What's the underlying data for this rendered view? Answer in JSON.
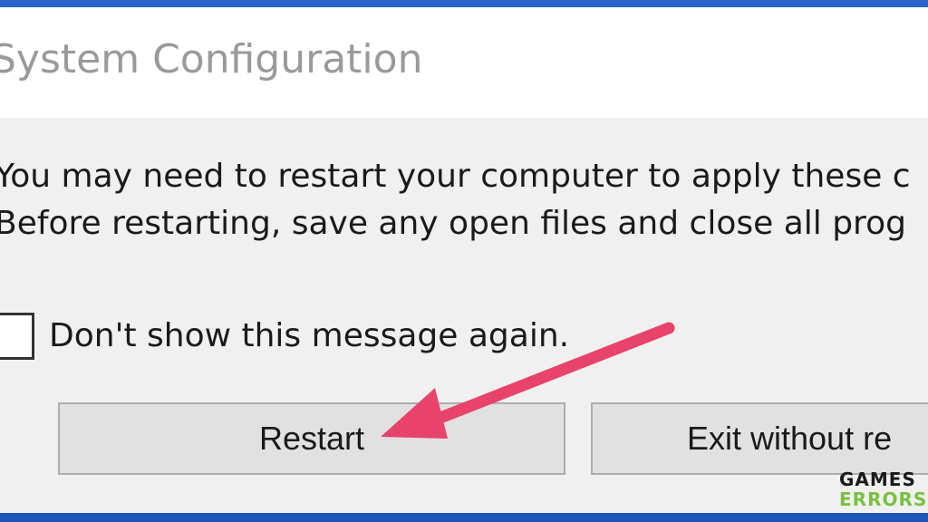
{
  "window": {
    "title": "System Configuration"
  },
  "message": {
    "line1": "You may need to restart your computer to apply these c",
    "line2": "Before restarting, save any open files and close all prog"
  },
  "checkbox": {
    "label": "Don't show this message again.",
    "checked": false
  },
  "buttons": {
    "restart_label": "Restart",
    "exit_label": "Exit without re"
  },
  "annotation": {
    "arrow_color": "#e8436a"
  },
  "watermark": {
    "line1": "GAMES",
    "line2": "ERRORS",
    "colors": {
      "games": "#1a1a1a",
      "errors": "#79c142"
    }
  }
}
